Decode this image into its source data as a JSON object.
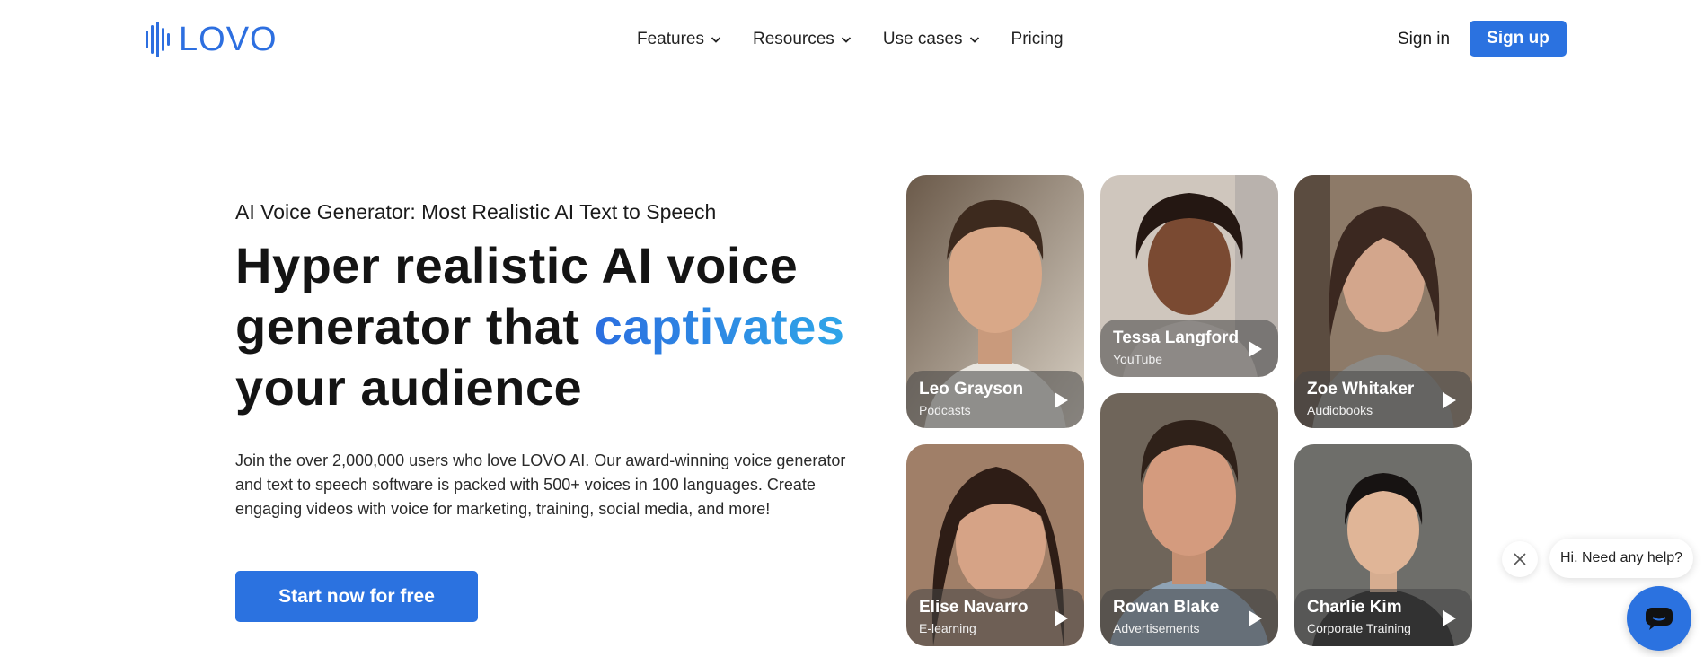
{
  "brand": {
    "name": "LOVO",
    "color": "#2d6fe0"
  },
  "nav": {
    "items": [
      {
        "label": "Features",
        "has_dropdown": true
      },
      {
        "label": "Resources",
        "has_dropdown": true
      },
      {
        "label": "Use cases",
        "has_dropdown": true
      },
      {
        "label": "Pricing",
        "has_dropdown": false
      }
    ],
    "signin_label": "Sign in",
    "signup_label": "Sign up"
  },
  "hero": {
    "kicker": "AI Voice Generator: Most Realistic AI Text to Speech",
    "headline_part1": "Hyper realistic AI voice generator that ",
    "headline_accent": "captivates",
    "headline_part2": " your audience",
    "description": "Join the over 2,000,000 users who love LOVO AI. Our award-winning voice generator and text to speech software is packed with 500+ voices in 100 languages. Create engaging videos with voice for marketing, training, social media, and more!",
    "cta_label": "Start now for free"
  },
  "voices": [
    {
      "name": "Leo Grayson",
      "category": "Podcasts"
    },
    {
      "name": "Tessa Langford",
      "category": "YouTube"
    },
    {
      "name": "Zoe Whitaker",
      "category": "Audiobooks"
    },
    {
      "name": "Elise Navarro",
      "category": "E-learning"
    },
    {
      "name": "Rowan Blake",
      "category": "Advertisements"
    },
    {
      "name": "Charlie Kim",
      "category": "Corporate Training"
    }
  ],
  "chat": {
    "prompt": "Hi. Need any help?"
  },
  "colors": {
    "primary": "#2b72e0",
    "accent_gradient_start": "#2c6fe0",
    "accent_gradient_end": "#2fa6e8"
  }
}
